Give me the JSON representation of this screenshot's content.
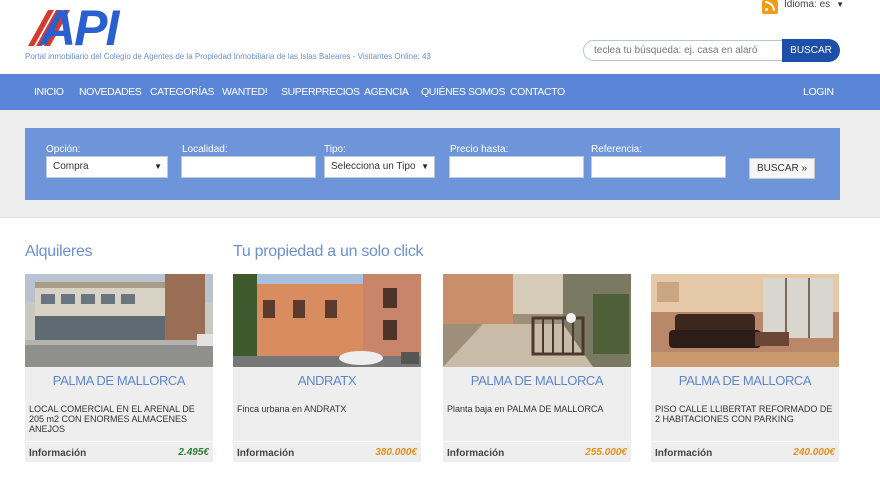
{
  "header": {
    "logo_text": "API",
    "tagline": "Portal inmobiliario del Colegio de Agentes de la Propiedad Inmobiliaria de las Islas Baleares - Visitantes Online: 43",
    "language_label": "Idioma: es",
    "search": {
      "placeholder": "teclea tu búsqueda: ej. casa en alaró",
      "button": "BUSCAR"
    }
  },
  "nav": {
    "items": [
      "INICIO",
      "NOVEDADES",
      "CATEGORÍAS",
      "WANTED!",
      "SUPERPRECIOS",
      "AGENCIA",
      "QUIÉNES SOMOS",
      "CONTACTO"
    ],
    "login": "LOGIN"
  },
  "filters": {
    "option": {
      "label": "Opción:",
      "value": "Compra"
    },
    "location": {
      "label": "Localidad:",
      "value": ""
    },
    "type": {
      "label": "Tipo:",
      "value": "Selecciona un Tipo"
    },
    "max_price": {
      "label": "Precio hasta:",
      "value": ""
    },
    "reference": {
      "label": "Referencia:",
      "value": ""
    },
    "button": "BUSCAR »"
  },
  "sections": {
    "rentals_title": "Alquileres",
    "click_title": "Tu propiedad a un solo click"
  },
  "listings": [
    {
      "city": "PALMA DE MALLORCA",
      "description": "LOCAL COMERCIAL EN EL ARENAL DE 205 m2 CON ENORMES ALMACENES ANEJOS",
      "info": "Información",
      "price": "2.495€",
      "price_color": "#2e7d32"
    },
    {
      "city": "ANDRATX",
      "description": "Finca urbana en ANDRATX",
      "info": "Información",
      "price": "380.000€",
      "price_color": "#e6901b"
    },
    {
      "city": "PALMA DE MALLORCA",
      "description": "Planta baja en PALMA DE MALLORCA",
      "info": "Información",
      "price": "255.000€",
      "price_color": "#e6901b"
    },
    {
      "city": "PALMA DE MALLORCA",
      "description": "PISO CALLE LLIBERTAT REFORMADO DE 2 HABITACIONES CON PARKING",
      "info": "Información",
      "price": "240.000€",
      "price_color": "#e6901b"
    }
  ],
  "colors": {
    "brand_blue": "#2a5fd0",
    "nav_blue": "#5b86d8",
    "panel_blue": "#6e94d9",
    "button_dark": "#1e4fa8"
  }
}
